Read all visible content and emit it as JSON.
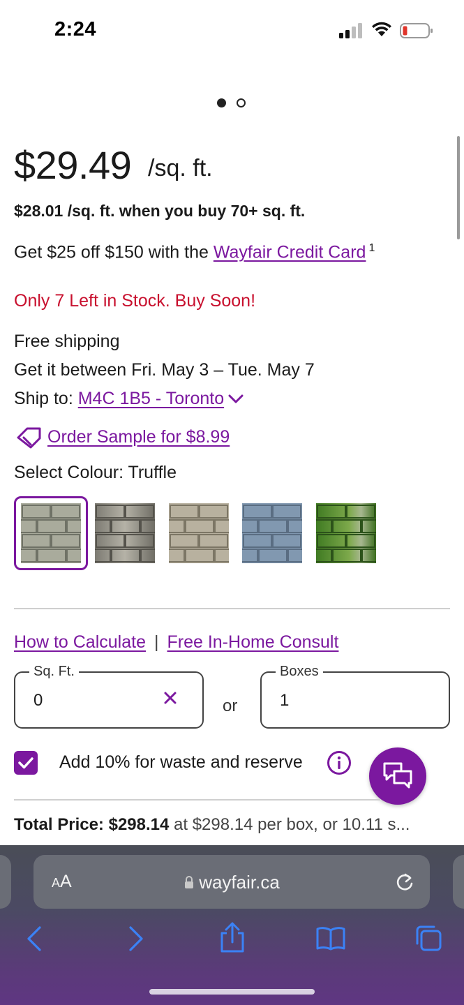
{
  "status_bar": {
    "time": "2:24"
  },
  "product": {
    "price": "$29.49",
    "price_unit": "/sq. ft.",
    "bulk_price": "$28.01 /sq. ft. when you buy 70+ sq. ft.",
    "credit_prefix": "Get $25 off $150 with the ",
    "credit_link": "Wayfair Credit Card",
    "credit_footnote": "1",
    "stock_warning": "Only 7 Left in Stock. Buy Soon!",
    "shipping_free": "Free shipping",
    "delivery_window": "Get it between Fri. May 3 – Tue. May 7",
    "ship_to_label": "Ship to: ",
    "ship_to_location": "M4C 1B5 - Toronto",
    "order_sample": "Order Sample for $8.99",
    "colour_label": "Select Colour: Truffle",
    "swatches": [
      {
        "name": "Truffle",
        "selected": true,
        "color": "#a9ab9c"
      },
      {
        "name": "Swatch 2",
        "selected": false,
        "color": "#8c8a80"
      },
      {
        "name": "Swatch 3",
        "selected": false,
        "color": "#b3ac9a"
      },
      {
        "name": "Swatch 4",
        "selected": false,
        "color": "#7f93ab"
      },
      {
        "name": "Swatch 5",
        "selected": false,
        "color": "#4f8a2a"
      }
    ]
  },
  "calculator": {
    "how_to_calculate": "How to Calculate",
    "separator": "|",
    "consult": "Free In-Home Consult",
    "sqft_label": "Sq. Ft.",
    "sqft_value": "0",
    "or_label": "or",
    "boxes_label": "Boxes",
    "boxes_value": "1",
    "waste_label": "Add 10% for waste and reserve",
    "waste_checked": true
  },
  "total": {
    "label": "Total Price:",
    "amount": "$298.14",
    "detail": " at $298.14 per box, or 10.11 s..."
  },
  "browser": {
    "aa_label_small": "A",
    "aa_label": "A",
    "domain": "wayfair.ca"
  },
  "colors": {
    "accent": "#7b189f",
    "stock_red": "#c8102e"
  }
}
